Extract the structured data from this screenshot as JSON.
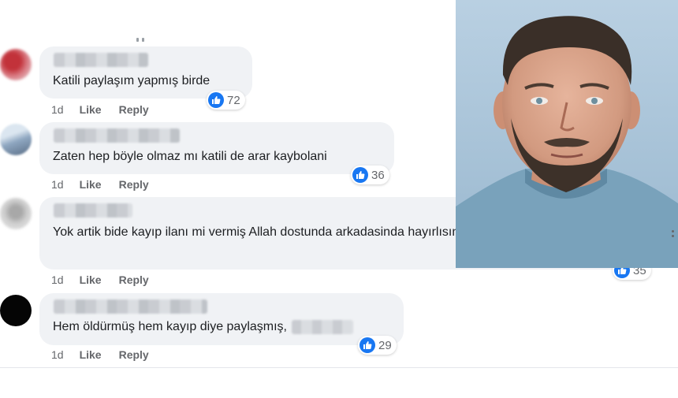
{
  "comments": [
    {
      "text": "Katili paylaşım yapmış birde",
      "reactions": 72,
      "age": "1d",
      "like_label": "Like",
      "reply_label": "Reply"
    },
    {
      "text": "Zaten hep böyle olmaz mı katili de arar kaybolani",
      "reactions": 36,
      "age": "1d",
      "like_label": "Like",
      "reply_label": "Reply"
    },
    {
      "text": "Yok artik bide kayıp ilanı mi vermiş Allah dostunda arkadasinda hayırlısını vicdanlisini versin",
      "reactions": 35,
      "age": "1d",
      "like_label": "Like",
      "reply_label": "Reply"
    },
    {
      "text": "Hem öldürmüş hem kayıp diye paylaşmış,",
      "reactions": 29,
      "age": "1d",
      "like_label": "Like",
      "reply_label": "Reply"
    }
  ],
  "icons": {
    "reaction": "like-thumb-icon",
    "avatar_blur": "blurred-avatar-icon"
  },
  "colors": {
    "like_blue": "#1877f2",
    "bubble": "#f0f2f5",
    "meta_gray": "#65676b"
  }
}
